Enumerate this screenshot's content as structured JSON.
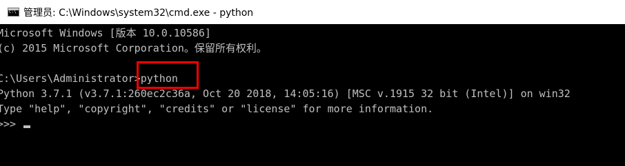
{
  "window": {
    "title": "管理员: C:\\Windows\\system32\\cmd.exe - python",
    "icon": "cmd-icon"
  },
  "console": {
    "lines": [
      "Microsoft Windows [版本 10.0.10586]",
      "(c) 2015 Microsoft Corporation。保留所有权利。",
      "",
      "C:\\Users\\Administrator>python",
      "Python 3.7.1 (v3.7.1:260ec2c36a, Oct 20 2018, 14:05:16) [MSC v.1915 32 bit (Intel)] on win32",
      "Type \"help\", \"copyright\", \"credits\" or \"license\" for more information."
    ],
    "prompt": ">>> "
  },
  "annotation": {
    "color": "#ff0000"
  }
}
